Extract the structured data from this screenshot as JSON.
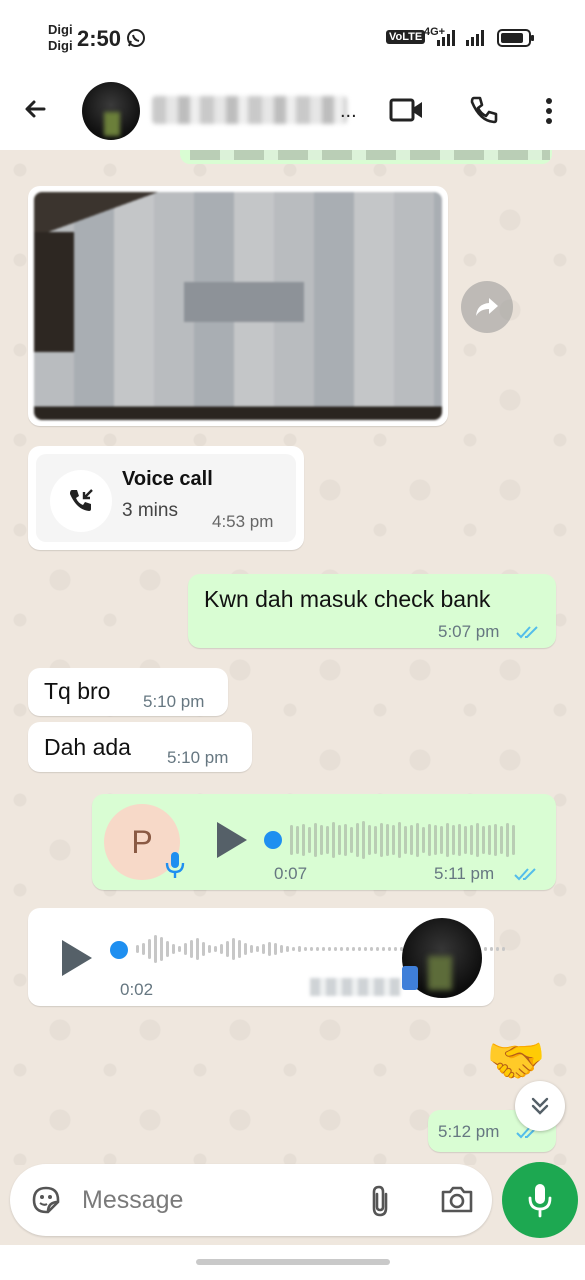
{
  "status_bar": {
    "carrier_1": "Digi",
    "carrier_2": "Digi",
    "time": "2:50",
    "volte": "VoLTE",
    "network": "4G+",
    "icons": [
      "whatsapp-icon",
      "signal-icon",
      "battery-icon"
    ]
  },
  "header": {
    "name_suffix": "...",
    "icons": [
      "back-arrow-icon",
      "video-call-icon",
      "phone-icon",
      "more-vert-icon"
    ]
  },
  "messages": {
    "voice_call": {
      "title": "Voice call",
      "duration": "3 mins",
      "time": "4:53 pm"
    },
    "out_1": {
      "text": "Kwn dah masuk check bank",
      "time": "5:07 pm"
    },
    "in_1": {
      "text": "Tq bro",
      "time": "5:10 pm"
    },
    "in_2": {
      "text": "Dah ada",
      "time": "5:10 pm"
    },
    "voice_out": {
      "avatar_letter": "P",
      "duration": "0:07",
      "time": "5:11 pm"
    },
    "voice_in": {
      "duration": "0:02"
    },
    "emoji": {
      "text": "🤝"
    },
    "out_last": {
      "time": "5:12 pm"
    }
  },
  "input": {
    "placeholder": "Message"
  },
  "colors": {
    "chat_bg": "#efe7de",
    "out_bubble": "#d9fdd3",
    "in_bubble": "#ffffff",
    "read_ticks": "#53bdeb",
    "progress": "#1f8ff0",
    "mic_button": "#1da851"
  }
}
